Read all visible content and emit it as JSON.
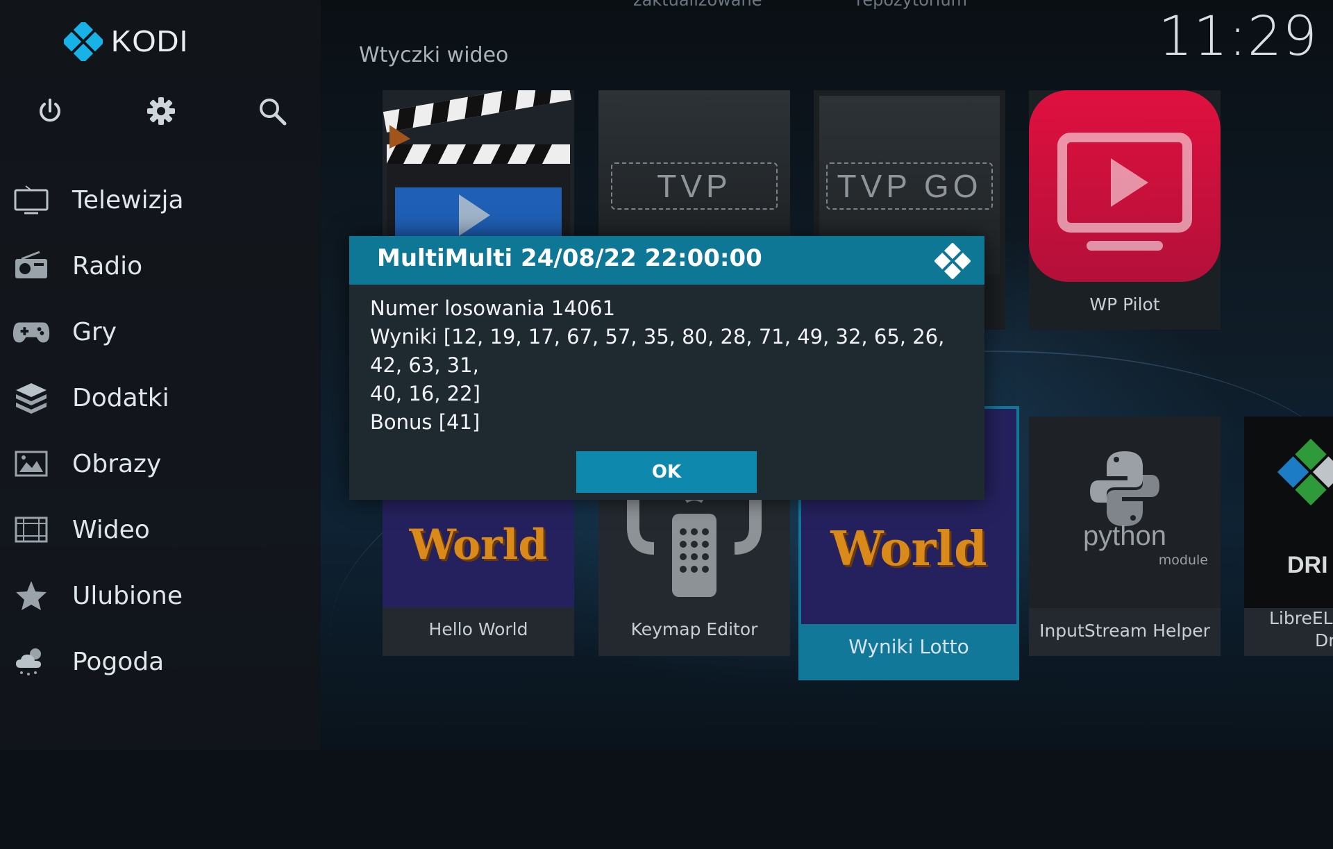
{
  "top_hints": [
    "zaktualizowane",
    "repozytorium"
  ],
  "logo": {
    "text": "KODI"
  },
  "clock": "11:29",
  "section_title": "Wtyczki wideo",
  "sidebar": {
    "top_buttons": [
      "power-icon",
      "gear-icon",
      "search-icon"
    ],
    "items": [
      {
        "label": "Telewizja",
        "icon": "tv-icon"
      },
      {
        "label": "Radio",
        "icon": "radio-icon"
      },
      {
        "label": "Gry",
        "icon": "gamepad-icon"
      },
      {
        "label": "Dodatki",
        "icon": "box-icon"
      },
      {
        "label": "Obrazy",
        "icon": "picture-icon"
      },
      {
        "label": "Wideo",
        "icon": "film-icon"
      },
      {
        "label": "Ulubione",
        "icon": "star-icon"
      },
      {
        "label": "Pogoda",
        "icon": "weather-icon"
      }
    ]
  },
  "tiles_row1": [
    {
      "label": ""
    },
    {
      "label": "",
      "logo_text": "TVP"
    },
    {
      "label": "",
      "logo_text": "TVP GO"
    },
    {
      "label": "WP Pilot"
    }
  ],
  "tiles_row2": [
    {
      "label": "Hello World",
      "art_text": "World"
    },
    {
      "label": "Keymap Editor"
    },
    {
      "label": "Wyniki Lotto",
      "art_text": "World"
    },
    {
      "label": "InputStream Helper",
      "art_text": "python",
      "art_sub": "module"
    },
    {
      "label_line1": "LibreELE",
      "label_line2": "Dr",
      "art_text": "DRI"
    }
  ],
  "dialog": {
    "title": "MultiMulti 24/08/22 22:00:00",
    "lines": [
      "Numer losowania 14061",
      "Wyniki [12, 19, 17, 67, 57, 35, 80, 28, 71, 49, 32, 65, 26, 42, 63, 31,",
      "40, 16, 22]",
      "Bonus [41]"
    ],
    "ok_label": "OK"
  },
  "colors": {
    "accent": "#0f7796",
    "button": "#0f88ad",
    "wp_pilot": "#c8103c"
  }
}
